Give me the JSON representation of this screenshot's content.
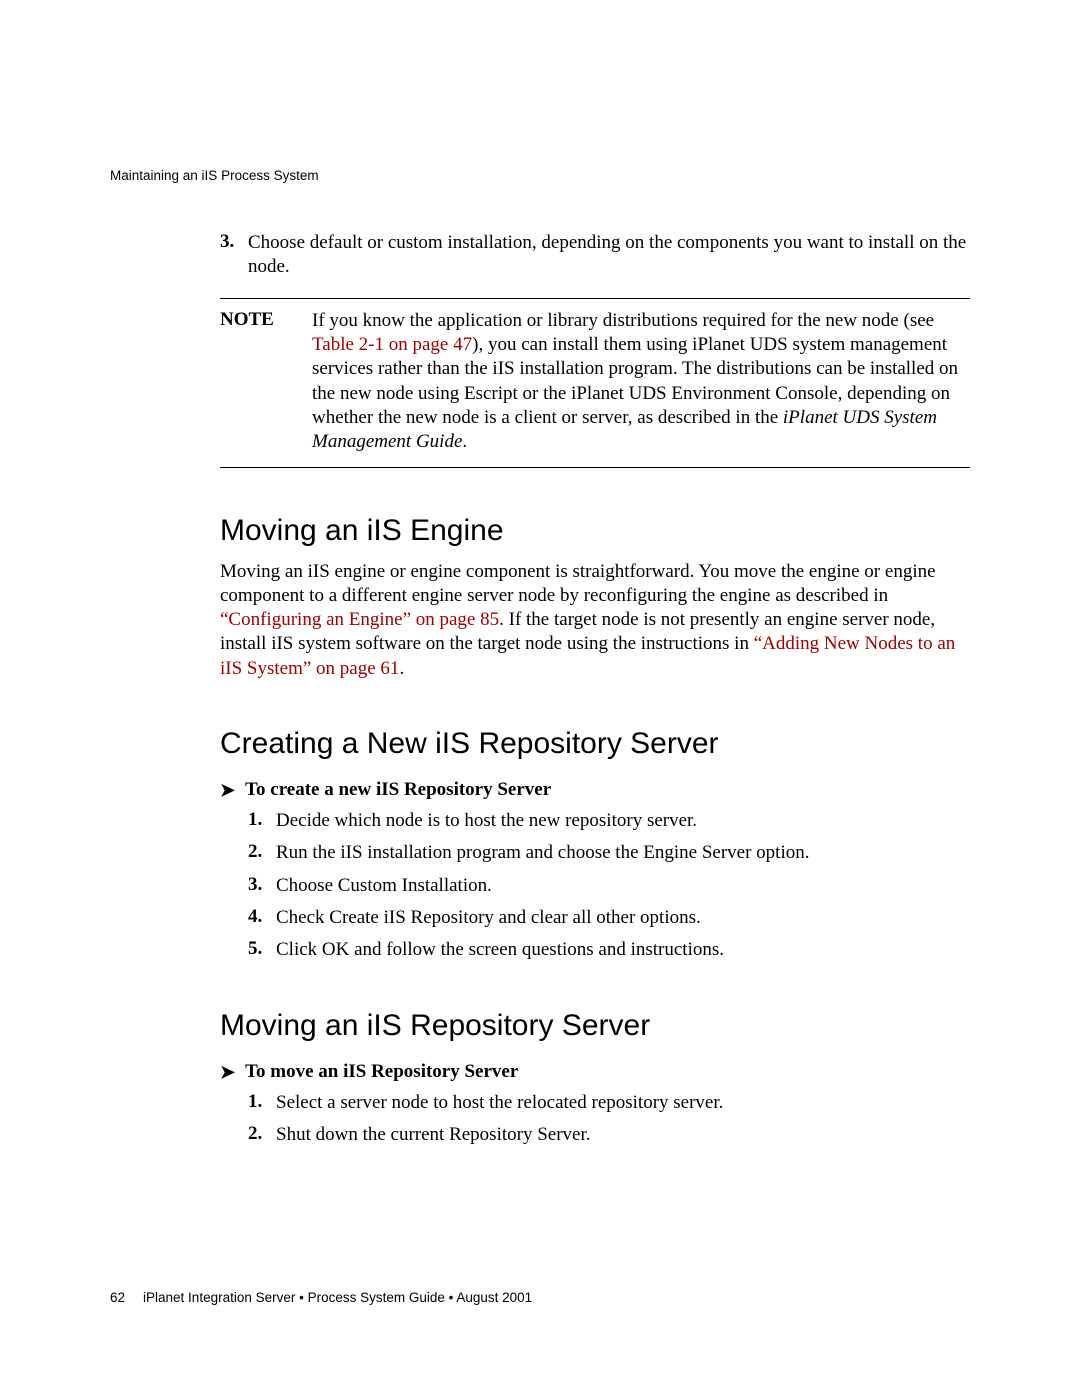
{
  "header": {
    "running": "Maintaining an iIS Process System"
  },
  "intro_step": {
    "num": "3.",
    "text": "Choose default or custom installation, depending on the components you want to install on the node."
  },
  "note": {
    "label": "NOTE",
    "pre": "If you know the application or library distributions required for the new node (see ",
    "link": "Table 2-1 on page 47",
    "post1": "), you can install them using iPlanet UDS system management services rather than the iIS installation program. The distributions can be installed on the new node using Escript or the iPlanet UDS Environment Console, depending on whether the new node is a client or server, as described in the ",
    "ital": "iPlanet UDS System Management Guide",
    "post2": "."
  },
  "s1": {
    "title": "Moving an iIS Engine",
    "p_a": "Moving an iIS engine or engine component is straightforward. You move the engine or engine component to a different engine server node by reconfiguring the engine as described in ",
    "link1": "“Configuring an Engine” on page 85",
    "p_b": ". If the target node is not presently an engine server node, install iIS system software on the target node using the instructions in ",
    "link2": "“Adding New Nodes to an iIS System” on page 61",
    "p_c": "."
  },
  "s2": {
    "title": "Creating a New iIS Repository Server",
    "proc": "To create a new iIS Repository Server",
    "steps": {
      "n1": "1.",
      "t1": "Decide which node is to host the new repository server.",
      "n2": "2.",
      "t2": "Run the iIS installation program and choose the Engine Server option.",
      "n3": "3.",
      "t3": "Choose Custom Installation.",
      "n4": "4.",
      "t4": "Check Create iIS Repository and clear all other options.",
      "n5": "5.",
      "t5": "Click OK and follow the screen questions and instructions."
    }
  },
  "s3": {
    "title": "Moving an iIS Repository Server",
    "proc": "To move an iIS Repository Server",
    "steps": {
      "n1": "1.",
      "t1": "Select a server node to host the relocated repository server.",
      "n2": "2.",
      "t2": "Shut down the current Repository Server."
    }
  },
  "footer": {
    "page": "62",
    "text": "iPlanet Integration Server • Process System Guide • August 2001"
  }
}
